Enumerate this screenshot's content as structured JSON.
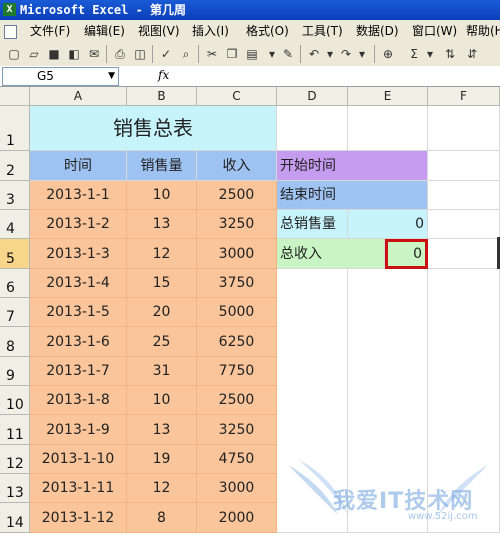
{
  "window": {
    "title": "Microsoft Excel - 第几周"
  },
  "menu": [
    {
      "label": "文件(F)"
    },
    {
      "label": "编辑(E)"
    },
    {
      "label": "视图(V)"
    },
    {
      "label": "插入(I)"
    },
    {
      "label": "格式(O)"
    },
    {
      "label": "工具(T)"
    },
    {
      "label": "数据(D)"
    },
    {
      "label": "窗口(W)"
    },
    {
      "label": "帮助(H)"
    }
  ],
  "toolbar_icons": [
    "new-icon",
    "open-icon",
    "save-icon",
    "permission-icon",
    "email-icon",
    "print-icon",
    "print-preview-icon",
    "spelling-icon",
    "research-icon",
    "cut-icon",
    "copy-icon",
    "paste-icon",
    "format-painter-icon",
    "undo-icon",
    "redo-icon",
    "hyperlink-icon",
    "autosum-icon",
    "sort-ascending-icon"
  ],
  "formula_bar": {
    "name_box": "G5",
    "fx_label": "fx",
    "content": ""
  },
  "columns": [
    "A",
    "B",
    "C",
    "D",
    "E",
    "F"
  ],
  "rows": [
    "1",
    "2",
    "3",
    "4",
    "5",
    "6",
    "7",
    "8",
    "9",
    "10",
    "11",
    "12",
    "13",
    "14"
  ],
  "sheet": {
    "title": "销售总表",
    "headers": {
      "time": "时间",
      "sales": "销售量",
      "income": "收入"
    },
    "records": [
      {
        "date": "2013-1-1",
        "sales": "10",
        "income": "2500"
      },
      {
        "date": "2013-1-2",
        "sales": "13",
        "income": "3250"
      },
      {
        "date": "2013-1-3",
        "sales": "12",
        "income": "3000"
      },
      {
        "date": "2013-1-4",
        "sales": "15",
        "income": "3750"
      },
      {
        "date": "2013-1-5",
        "sales": "20",
        "income": "5000"
      },
      {
        "date": "2013-1-6",
        "sales": "25",
        "income": "6250"
      },
      {
        "date": "2013-1-7",
        "sales": "31",
        "income": "7750"
      },
      {
        "date": "2013-1-8",
        "sales": "10",
        "income": "2500"
      },
      {
        "date": "2013-1-9",
        "sales": "13",
        "income": "3250"
      },
      {
        "date": "2013-1-10",
        "sales": "19",
        "income": "4750"
      },
      {
        "date": "2013-1-11",
        "sales": "12",
        "income": "3000"
      },
      {
        "date": "2013-1-12",
        "sales": "8",
        "income": "2000"
      }
    ],
    "summary": {
      "start_label": "开始时间",
      "end_label": "结束时间",
      "total_sales_label": "总销售量",
      "total_sales_value": "0",
      "total_income_label": "总收入",
      "total_income_value": "0"
    }
  },
  "watermark": {
    "text": "我爱IT技术网",
    "url": "www.52ij.com"
  },
  "colors": {
    "peach": "#fac59a",
    "blue": "#9ec2f2",
    "cyan": "#c7f3fb",
    "purple": "#c69cf0",
    "green": "#c9f5c4",
    "active_border": "#c81010"
  }
}
